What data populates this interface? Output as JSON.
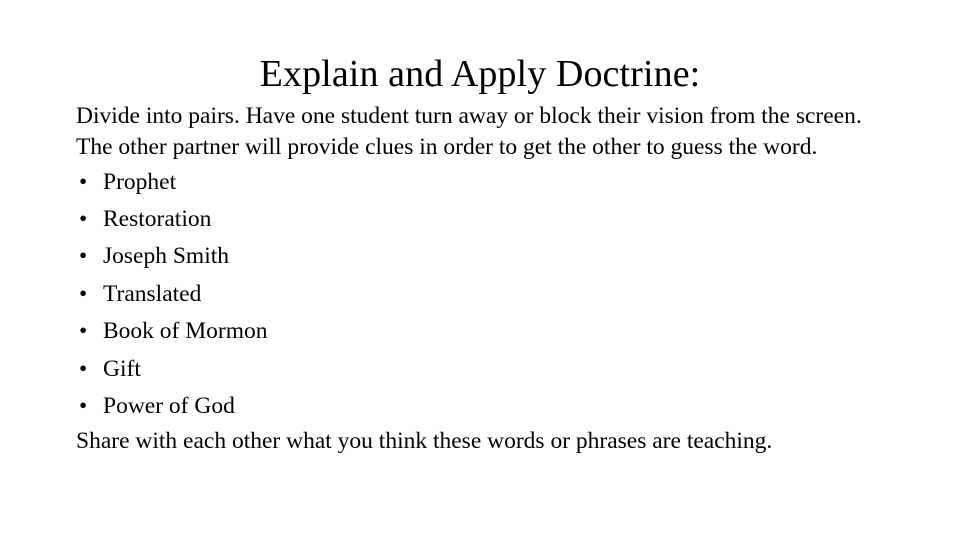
{
  "slide": {
    "background_color": "#ffffff",
    "text_color": "#000000",
    "title": "Explain and Apply Doctrine:",
    "intro_paragraph": "Divide into pairs. Have one student turn away or block their vision from the screen.  The other partner will provide clues in order to get the other to guess the word.",
    "bullet_marker": "•",
    "bullets": [
      {
        "label": "Prophet"
      },
      {
        "label": "Restoration"
      },
      {
        "label": "Joseph Smith"
      },
      {
        "label": "Translated"
      },
      {
        "label": "Book of Mormon"
      },
      {
        "label": "Gift"
      },
      {
        "label": "Power of God"
      }
    ],
    "closing_paragraph": "Share with each other what you think these words or phrases are teaching."
  }
}
